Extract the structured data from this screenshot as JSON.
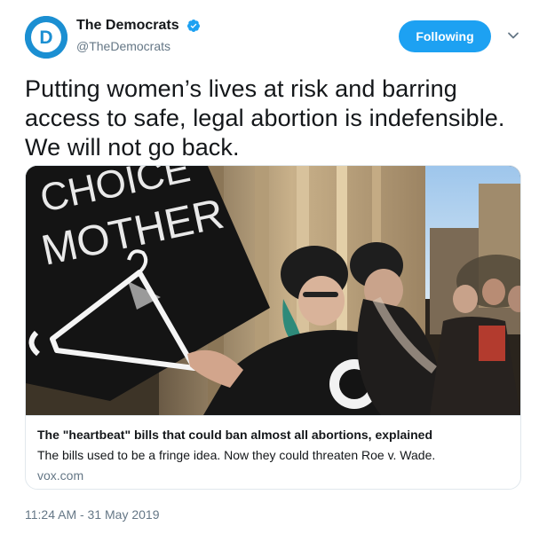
{
  "author": {
    "display_name": "The Democrats",
    "handle": "@TheDemocrats",
    "avatar_letter": "D",
    "verified_icon": "verified-badge-icon"
  },
  "follow_button": {
    "label": "Following"
  },
  "menu": {
    "icon": "chevron-down-icon"
  },
  "tweet": {
    "text": "Putting women’s lives at risk and barring access to safe, legal abortion is indefensible. We will not go back."
  },
  "card": {
    "image_sign_text": [
      "CHOICE",
      "MOTHER"
    ],
    "title": "The \"heartbeat\" bills that could ban almost all abortions, explained",
    "description": "The bills used to be a fringe idea. Now they could threaten Roe v. Wade.",
    "domain": "vox.com"
  },
  "timestamp": "11:24 AM - 31 May 2019",
  "colors": {
    "accent": "#1da1f2",
    "avatar": "#1b8fd2",
    "secondary_text": "#657786",
    "border": "#e1e8ed"
  }
}
